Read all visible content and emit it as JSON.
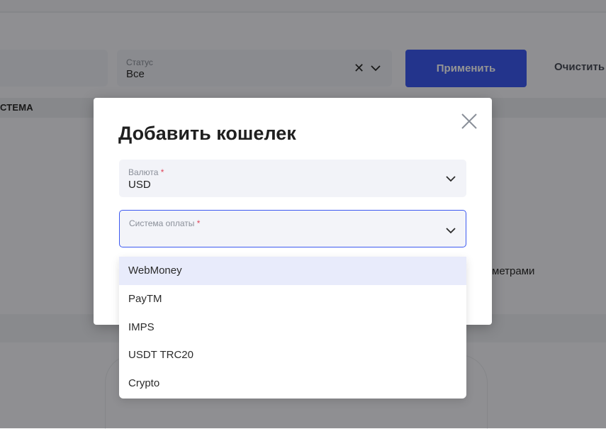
{
  "background": {
    "filters": {
      "status_label": "Статус",
      "status_value": "Все",
      "apply_label": "Применить",
      "clear_label": "Очистить"
    },
    "table": {
      "column_label": "СТЕМА"
    },
    "empty_text": "метрами"
  },
  "modal": {
    "title": "Добавить кошелек",
    "currency": {
      "label": "Валюта",
      "required_mark": "*",
      "value": "USD"
    },
    "payment_system": {
      "label": "Система оплаты",
      "required_mark": "*",
      "value": ""
    },
    "options": [
      "WebMoney",
      "PayTM",
      "IMPS",
      "USDT TRC20",
      "Crypto"
    ],
    "highlighted_option": "WebMoney"
  },
  "icons": {
    "close": "close-icon",
    "chevron": "chevron-down-icon",
    "clear": "clear-x-icon"
  },
  "colors": {
    "accent": "#3d5af1",
    "required": "#e0455b",
    "highlight": "#e8ebfb"
  }
}
